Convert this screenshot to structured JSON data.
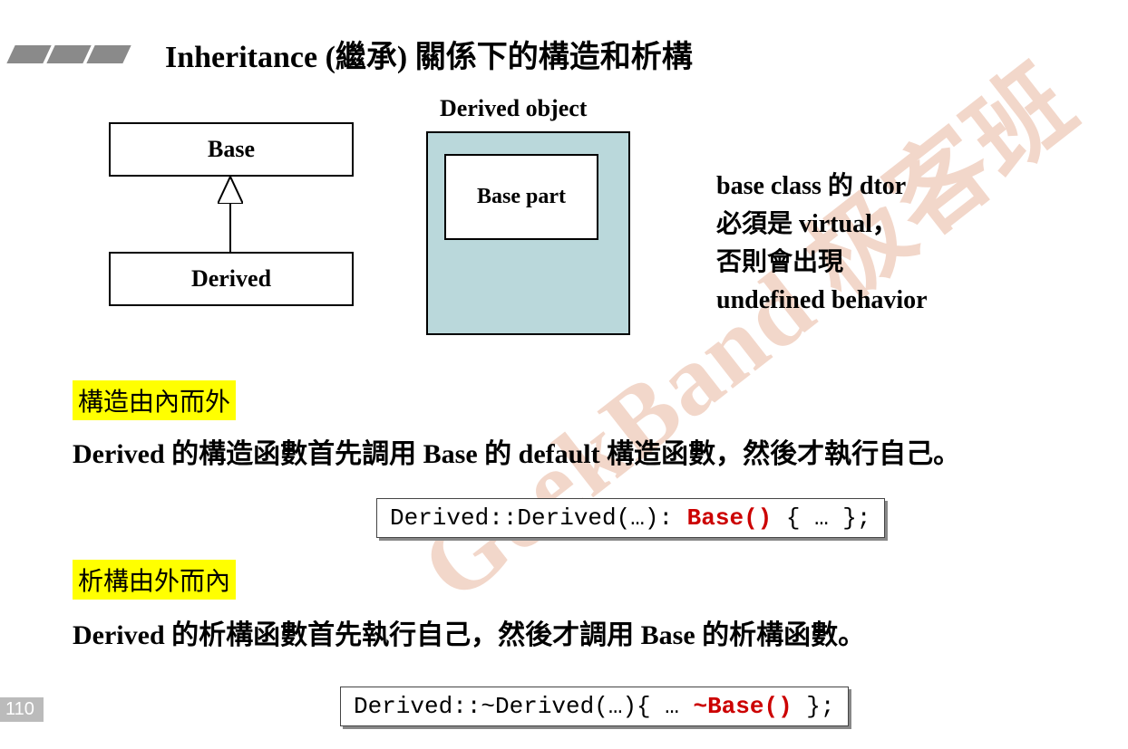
{
  "title": "Inheritance (繼承) 關係下的構造和析構",
  "watermark": "GeekBand 极客班",
  "uml": {
    "base": "Base",
    "derived": "Derived"
  },
  "diagram": {
    "label": "Derived object",
    "inner": "Base part"
  },
  "side_note": {
    "l1": "base class 的 dtor",
    "l2": "必須是 virtual，",
    "l3": "否則會出現",
    "l4": "undefined behavior"
  },
  "sections": {
    "construct": {
      "highlight": "構造由內而外",
      "text": "Derived 的構造函數首先調用 Base 的 default 構造函數，然後才執行自己。",
      "code_plain1": "Derived::Derived(…): ",
      "code_red": "Base()",
      "code_plain2": " { … };"
    },
    "destruct": {
      "highlight": "析構由外而內",
      "text": "Derived 的析構函數首先執行自己，然後才調用 Base 的析構函數。",
      "code_plain1": "Derived::~Derived(…){ … ",
      "code_red": "~Base()",
      "code_plain2": " };"
    }
  },
  "page_number": "110"
}
